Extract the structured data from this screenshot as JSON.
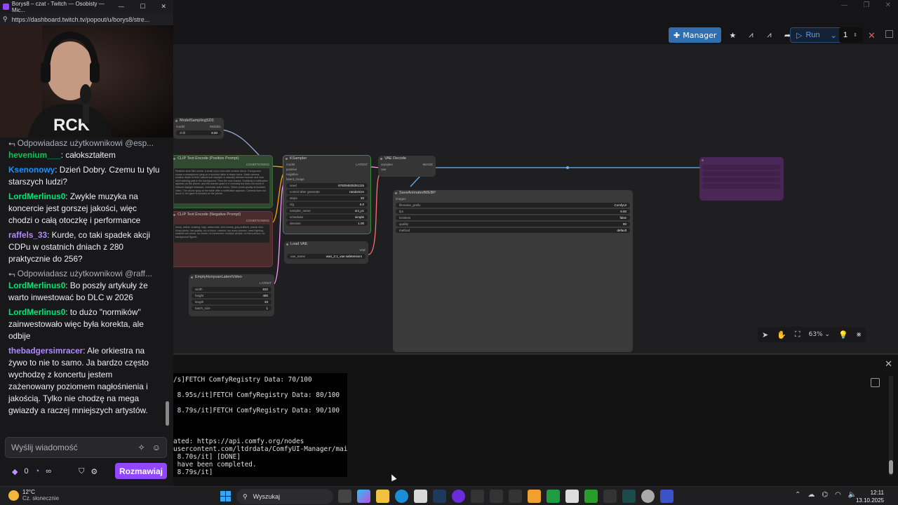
{
  "twitch": {
    "window_title": "Borys8 – czat - Twitch — Osobisty — Mic...",
    "url": "https://dashboard.twitch.tv/popout/u/borys8/stre...",
    "chat": [
      {
        "type": "reply",
        "text": "Odpowiadasz użytkownikowi @esp..."
      },
      {
        "type": "msg",
        "user": "hevenium___",
        "color": "#00c853",
        "text": ": całokształtem"
      },
      {
        "type": "msg",
        "user": "Ksenonowy",
        "color": "#1e90ff",
        "text": ": Dzień Dobry. Czemu tu tylu starszych ludzi?"
      },
      {
        "type": "msg",
        "user": "LordMerlinus0",
        "color": "#00e676",
        "text": ": Zwykle muzyka na koncercie jest gorszej jakości, więc chodzi o całą otoczkę i performance"
      },
      {
        "type": "msg",
        "user": "raffels_33",
        "color": "#b388ff",
        "text": ": Kurde, co taki spadek akcji CDPu w ostatnich dniach z 280 praktycznie do 256?"
      },
      {
        "type": "reply",
        "text": "Odpowiadasz użytkownikowi @raff..."
      },
      {
        "type": "msg",
        "user": "LordMerlinus0",
        "color": "#00e676",
        "text": ": Bo poszły artykuły że warto inwestować bo DLC w 2026"
      },
      {
        "type": "msg",
        "user": "LordMerlinus0",
        "color": "#00e676",
        "text": ": to dużo \"normików\" zainwestowało więc była korekta, ale odbije"
      },
      {
        "type": "msg",
        "user": "thebadgersimracer",
        "color": "#b388ff",
        "text": ": Ale orkiestra na żywo to nie to samo. Ja bardzo często wychodzę z koncertu jestem zażenowany poziomem nagłośnienia i jakością. Tylko nie chodzę na mega gwiazdy a raczej mniejszych artystów."
      }
    ],
    "input_placeholder": "Wyślij wiadomość",
    "points": "0",
    "points_symbol": "∞",
    "send_label": "Rozmawiaj",
    "accent": "#9146ff"
  },
  "comfy": {
    "manager_label": "Manager",
    "run_label": "Run",
    "run_count": "1",
    "zoom": "63%",
    "nodes": {
      "model_sampling": {
        "title": "ModelSamplingSD3",
        "out": "MODEL",
        "w1": [
          "model",
          ""
        ],
        "w2": [
          "shift",
          "8.00"
        ]
      },
      "pos_prompt": {
        "title": "CLIP Text Encode (Positive Prompt)",
        "out": "CONDITIONING",
        "text": "Realistic short film scene: a small cozy room with modern decor. Foreground shows a smartphone lying on a wooden table in sharp focus. Static camera, shallow depth of field, natural soft daylight. A casually dressed woman and man stroll walking past in the background. Then the man leaves. Suddenly a notification appears on the phone, and the woman goes to it curiously but does not touch it. Natural daylight shadows, cinematic warm tones, 35mm photo-quality at lossless video. The phone lying on the table after a notification appears, Camera does not touch it, her gaze is focused on the phone."
      },
      "neg_prompt": {
        "title": "CLIP Text Encode (Negative Prompt)",
        "out": "CONDITIONING",
        "text": "blurry, anime, drawing, logo, watermark, text overlay, jpeg artifacts, plastic skin, blurry photo, low quality, out of focus, cartoon, too many phones, harsh lighting, washed out colors, no crowd, no movement, multiple people, no third person, no background figures"
      },
      "ksampler": {
        "title": "KSampler",
        "out": "LATENT",
        "inputs": [
          "model",
          "positive",
          "negative",
          "latent_image"
        ],
        "widgets": [
          [
            "seed",
            "878294635351115"
          ],
          [
            "control after generate",
            "randomize"
          ],
          [
            "steps",
            "20"
          ],
          [
            "cfg",
            "6.0"
          ],
          [
            "sampler_name",
            "uni_pc"
          ],
          [
            "scheduler",
            "simple"
          ],
          [
            "denoise",
            "1.00"
          ]
        ]
      },
      "vae_decode": {
        "title": "VAE Decode",
        "in1": "samples",
        "in2": "vae",
        "out": "IMAGE"
      },
      "save_webp": {
        "title": "SaveAnimatedWEBP",
        "in": "images",
        "widgets": [
          [
            "filename_prefix",
            "ComfyUI"
          ],
          [
            "fps",
            "8.00"
          ],
          [
            "lossless",
            "false"
          ],
          [
            "quality",
            "90"
          ],
          [
            "method",
            "default"
          ]
        ]
      },
      "load_vae": {
        "title": "Load VAE",
        "out": "VAE",
        "w": [
          "vae_name",
          "wan_2.1_vae.safetensors"
        ]
      },
      "empty_latent": {
        "title": "EmptyHunyuanLatentVideo",
        "out": "LATENT",
        "widgets": [
          [
            "width",
            "832"
          ],
          [
            "height",
            "480"
          ],
          [
            "length",
            "33"
          ],
          [
            "batch_size",
            "1"
          ]
        ]
      }
    },
    "console_lines": [
      "/s]FETCH ComfyRegistry Data: 70/100",
      "",
      " 8.95s/it]FETCH ComfyRegistry Data: 80/100",
      "",
      " 8.79s/it]FETCH ComfyRegistry Data: 90/100",
      "",
      "",
      "",
      "ated: https://api.comfy.org/nodes",
      "usercontent.com/ltdrdata/ComfyUI-Manager/main",
      " 8.70s/it] [DONE]",
      " have been completed.",
      " 8.79s/it]"
    ]
  },
  "taskbar": {
    "temp": "12°C",
    "weather": "Cz. słonecznie",
    "search": "Wyszukaj",
    "time": "12:11",
    "date": "13.10.2025"
  }
}
